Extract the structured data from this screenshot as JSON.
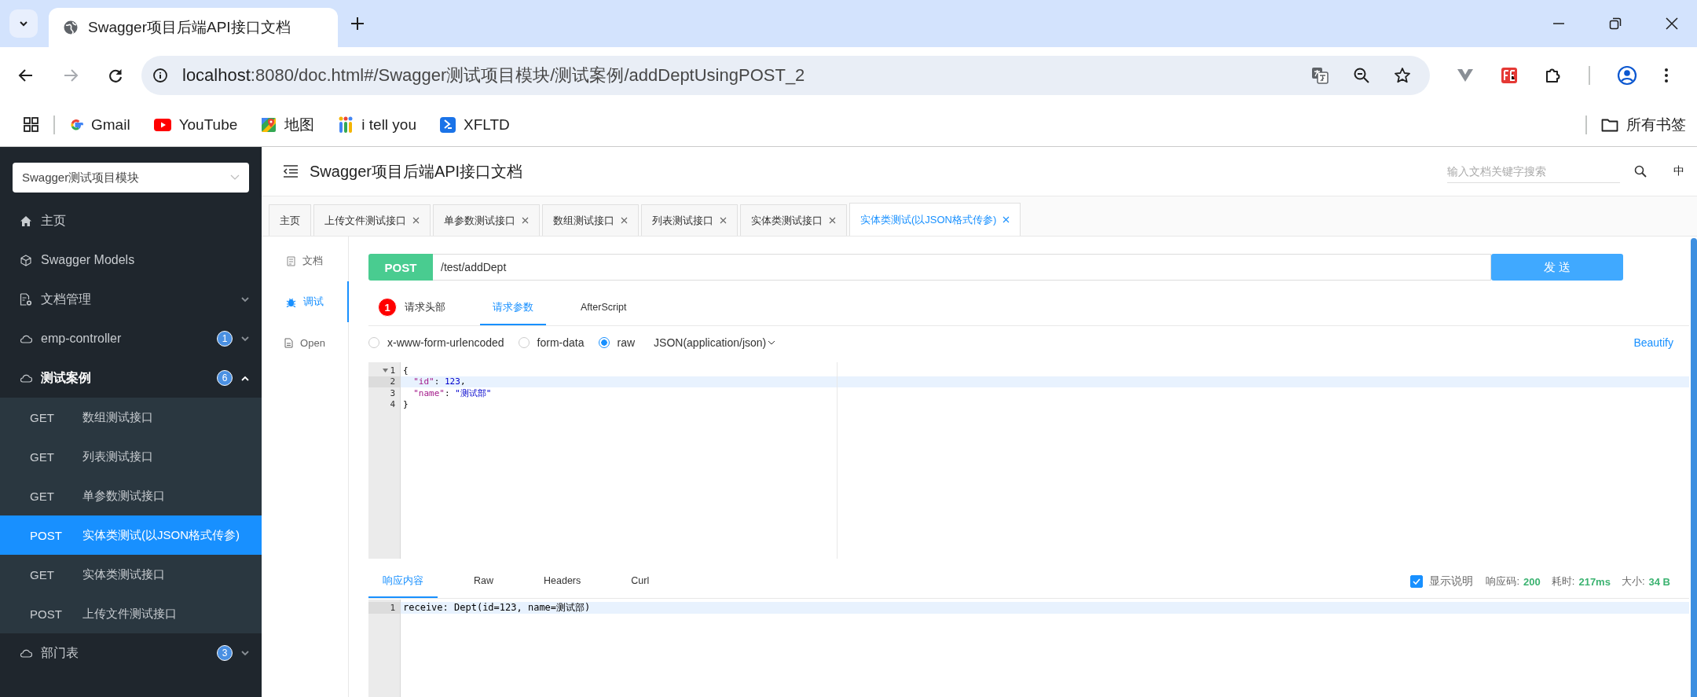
{
  "browser": {
    "tab_title": "Swagger项目后端API接口文档",
    "url_host": "localhost",
    "url_rest": ":8080/doc.html#/Swagger测试项目模块/测试案例/addDeptUsingPOST_2",
    "bookmarks": [
      {
        "label": "Gmail",
        "kind": "gmail"
      },
      {
        "label": "YouTube",
        "kind": "youtube"
      },
      {
        "label": "地图",
        "kind": "maps"
      },
      {
        "label": "i tell you",
        "kind": "itellyou"
      },
      {
        "label": "XFLTD",
        "kind": "xfltd"
      }
    ],
    "all_bookmarks": "所有书签"
  },
  "sidebar": {
    "module_select": "Swagger测试项目模块",
    "items": [
      {
        "label": "主页",
        "kind": "home"
      },
      {
        "label": "Swagger Models",
        "kind": "models"
      },
      {
        "label": "文档管理",
        "kind": "docs",
        "expanded": false
      },
      {
        "label": "emp-controller",
        "kind": "group",
        "count": "1",
        "expanded": false
      },
      {
        "label": "测试案例",
        "kind": "group",
        "count": "6",
        "expanded": true,
        "children": [
          {
            "method": "GET",
            "label": "数组测试接口",
            "selected": false
          },
          {
            "method": "GET",
            "label": "列表测试接口",
            "selected": false
          },
          {
            "method": "GET",
            "label": "单参数测试接口",
            "selected": false
          },
          {
            "method": "POST",
            "label": "实体类测试(以JSON格式传参)",
            "selected": true
          },
          {
            "method": "GET",
            "label": "实体类测试接口",
            "selected": false
          },
          {
            "method": "POST",
            "label": "上传文件测试接口",
            "selected": false
          }
        ]
      },
      {
        "label": "部门表",
        "kind": "group",
        "count": "3",
        "expanded": false
      }
    ]
  },
  "header": {
    "title": "Swagger项目后端API接口文档",
    "search_placeholder": "输入文档关键字搜索",
    "language": "中"
  },
  "tabs": [
    {
      "label": "主页",
      "closable": false,
      "selected": false
    },
    {
      "label": "上传文件测试接口",
      "closable": true,
      "selected": false
    },
    {
      "label": "单参数测试接口",
      "closable": true,
      "selected": false
    },
    {
      "label": "数组测试接口",
      "closable": true,
      "selected": false
    },
    {
      "label": "列表测试接口",
      "closable": true,
      "selected": false
    },
    {
      "label": "实体类测试接口",
      "closable": true,
      "selected": false
    },
    {
      "label": "实体类测试(以JSON格式传参)",
      "closable": true,
      "selected": true
    }
  ],
  "side_nav": [
    {
      "label": "文档",
      "kind": "doc",
      "selected": false
    },
    {
      "label": "调试",
      "kind": "debug",
      "selected": true
    },
    {
      "label": "Open",
      "kind": "open",
      "selected": false
    }
  ],
  "request": {
    "method": "POST",
    "url": "/test/addDept",
    "send": "发 送",
    "subtabs": [
      {
        "label": "请求头部",
        "badge": "1",
        "selected": false
      },
      {
        "label": "请求参数",
        "selected": true
      },
      {
        "label": "AfterScript",
        "selected": false
      }
    ],
    "body_types": [
      {
        "label": "x-www-form-urlencoded",
        "selected": false
      },
      {
        "label": "form-data",
        "selected": false
      },
      {
        "label": "raw",
        "selected": true
      }
    ],
    "content_type": "JSON(application/json)",
    "beautify": "Beautify",
    "editor_lines": [
      {
        "number": "1",
        "foldable": true,
        "active": false,
        "tokens": [
          {
            "text": "{",
            "kind": "plain"
          }
        ]
      },
      {
        "number": "2",
        "foldable": false,
        "active": true,
        "tokens": [
          {
            "text": "  \"id\"",
            "kind": "key"
          },
          {
            "text": ": ",
            "kind": "plain"
          },
          {
            "text": "123",
            "kind": "number"
          },
          {
            "text": ",",
            "kind": "plain"
          }
        ]
      },
      {
        "number": "3",
        "foldable": false,
        "active": false,
        "tokens": [
          {
            "text": "  \"name\"",
            "kind": "key"
          },
          {
            "text": ": ",
            "kind": "plain"
          },
          {
            "text": "\"测试部\"",
            "kind": "string"
          }
        ]
      },
      {
        "number": "4",
        "foldable": false,
        "active": false,
        "tokens": [
          {
            "text": "}",
            "kind": "plain"
          }
        ]
      }
    ]
  },
  "response": {
    "tabs": [
      {
        "label": "响应内容",
        "selected": true
      },
      {
        "label": "Raw",
        "selected": false
      },
      {
        "label": "Headers",
        "selected": false
      },
      {
        "label": "Curl",
        "selected": false
      }
    ],
    "show_description": {
      "label": "显示说明",
      "checked": true
    },
    "status_label": "响应码:",
    "status": "200",
    "time_label": "耗时:",
    "time": "217ms",
    "size_label": "大小:",
    "size": "34 B",
    "lines": [
      {
        "number": "1",
        "text": "receive: Dept(id=123, name=测试部)",
        "active": true
      }
    ]
  }
}
